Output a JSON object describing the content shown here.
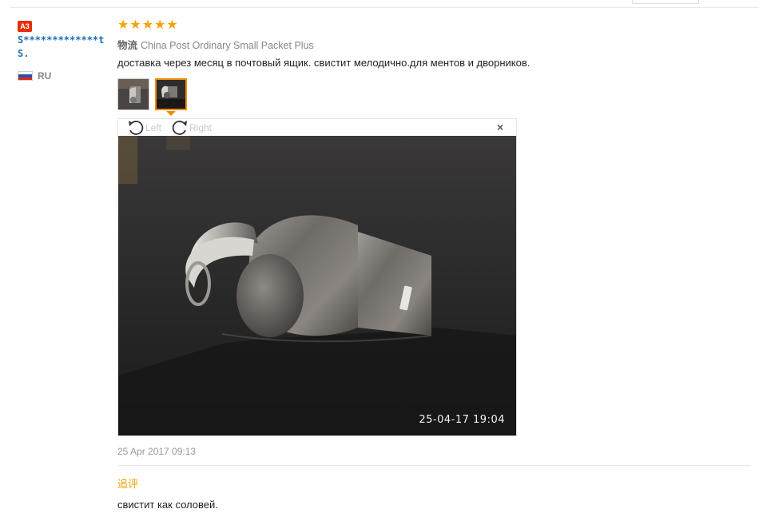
{
  "review": {
    "badge": "A3",
    "username": "S*************t S.",
    "country_code": "RU",
    "rating": 5,
    "stars": [
      "★",
      "★",
      "★",
      "★",
      "★"
    ],
    "logistics_label": "物流",
    "logistics_value": "China Post Ordinary Small Packet Plus",
    "text": "доставка через месяц в почтовый ящик. свистит мелодично.для ментов и дворников.",
    "date": "25 Apr 2017 09:13"
  },
  "photo_viewer": {
    "rotate_left_label": "Left",
    "rotate_right_label": "Right",
    "close_symbol": "×",
    "timestamp": "25-04-17  19:04",
    "thumbnails": [
      {
        "label": "whistle photo 1",
        "selected": false
      },
      {
        "label": "whistle photo 2",
        "selected": true
      }
    ]
  },
  "followup": {
    "label": "追评",
    "text": "свистит как соловей."
  },
  "colors": {
    "star": "#f7a200",
    "badge": "#e62e04",
    "username": "#1a6eb8",
    "selected_thumb": "#f08b00",
    "followup_label": "#e6a000"
  },
  "icons": [
    "rotate-left-icon",
    "rotate-right-icon",
    "close-icon",
    "flag-ru-icon",
    "star-icon"
  ]
}
